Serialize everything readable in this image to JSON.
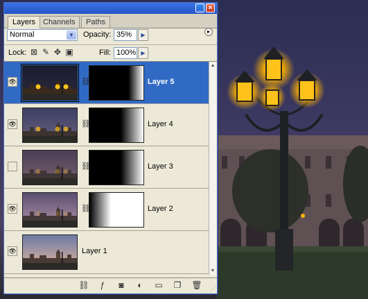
{
  "panel": {
    "tabs": [
      {
        "label": "Layers",
        "active": true
      },
      {
        "label": "Channels",
        "active": false
      },
      {
        "label": "Paths",
        "active": false
      }
    ],
    "blend_mode": "Normal",
    "opacity_label": "Opacity:",
    "opacity_value": "35%",
    "lock_label": "Lock:",
    "fill_label": "Fill:",
    "fill_value": "100%",
    "icons": {
      "minimize": "minimize-icon",
      "close": "close-icon",
      "menu": "palette-menu-icon",
      "lock": [
        "lock-transparency-icon",
        "lock-pixels-icon",
        "lock-position-icon",
        "lock-all-icon"
      ],
      "bottom": [
        "link-layers-icon",
        "layer-style-icon",
        "add-mask-icon",
        "adjustment-layer-icon",
        "new-group-icon",
        "new-layer-icon",
        "delete-layer-icon"
      ]
    }
  },
  "layers": [
    {
      "name": "Layer 5",
      "visible": true,
      "selected": true,
      "has_mask": true,
      "mask_fade": "left-to-right-white",
      "scene": "night"
    },
    {
      "name": "Layer 4",
      "visible": true,
      "selected": false,
      "has_mask": true,
      "mask_fade": "left-to-right-white",
      "scene": "dusk"
    },
    {
      "name": "Layer 3",
      "visible": false,
      "selected": false,
      "has_mask": true,
      "mask_fade": "left-to-right-white",
      "scene": "twilight"
    },
    {
      "name": "Layer 2",
      "visible": true,
      "selected": false,
      "has_mask": true,
      "mask_fade": "right-to-left-white",
      "scene": "evening"
    },
    {
      "name": "Layer 1",
      "visible": true,
      "selected": false,
      "has_mask": false,
      "scene": "sunset"
    }
  ],
  "colors": {
    "selection": "#316ac5",
    "titlebar": "#2354c6",
    "panel_bg": "#ece9d8",
    "lamp_glow": "#ffb300"
  }
}
